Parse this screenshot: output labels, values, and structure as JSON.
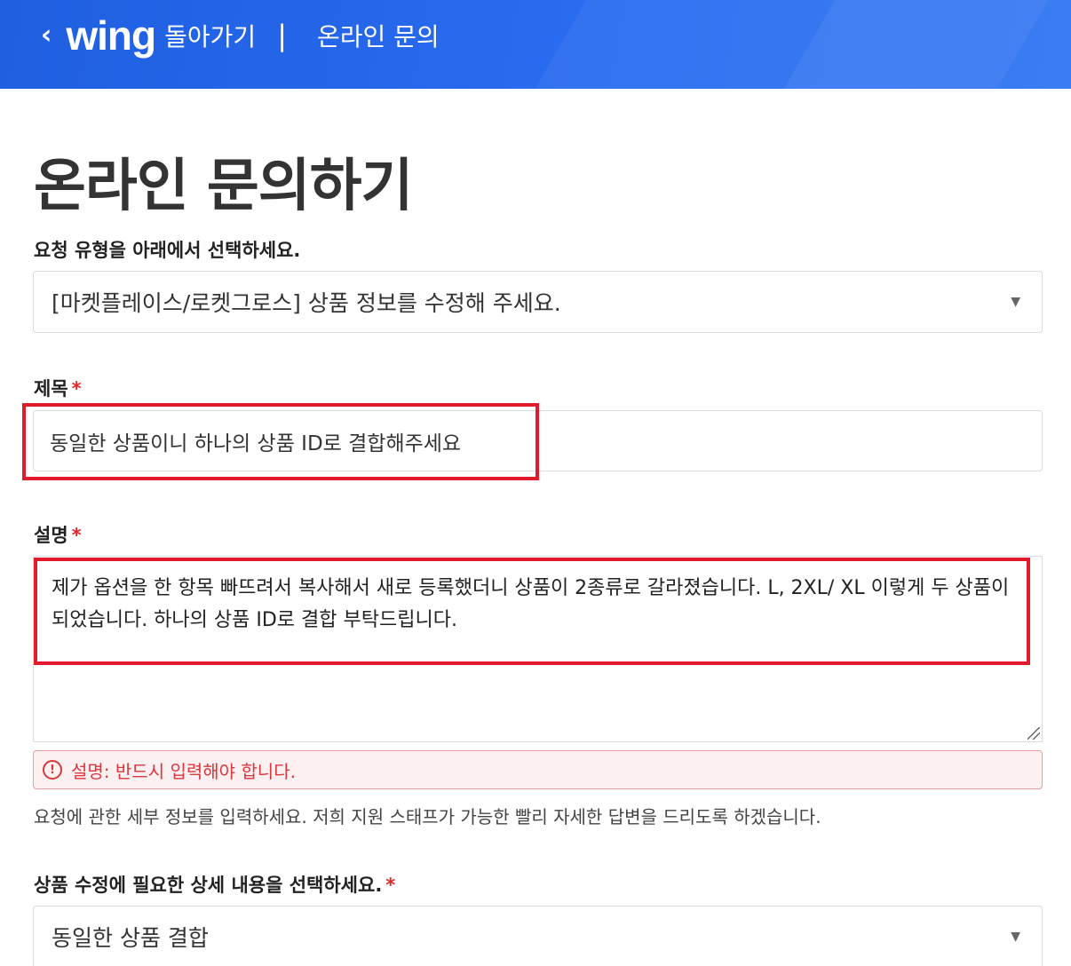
{
  "header": {
    "back_icon": "chevron-left-icon",
    "logo": "wing",
    "back_label": "돌아가기",
    "divider": "|",
    "breadcrumb": "온라인 문의"
  },
  "page": {
    "title": "온라인 문의하기"
  },
  "request_type": {
    "label": "요청 유형을 아래에서 선택하세요.",
    "value": "[마켓플레이스/로켓그로스] 상품 정보를 수정해 주세요.",
    "arrow": "▼"
  },
  "subject": {
    "label": "제목",
    "required": "*",
    "value": "동일한 상품이니 하나의 상품 ID로 결합해주세요"
  },
  "description": {
    "label": "설명",
    "required": "*",
    "value": "제가 옵션을 한 항목 빠뜨려서 복사해서 새로 등록했더니 상품이 2종류로 갈라졌습니다. L, 2XL/ XL 이렇게 두 상품이 되었습니다. 하나의 상품 ID로 결합 부탁드립니다.",
    "error_icon": "!",
    "error": "설명: 반드시 입력해야 합니다.",
    "help": "요청에 관한 세부 정보를 입력하세요. 저희 지원 스태프가 가능한 빨리 자세한 답변을 드리도록 하겠습니다."
  },
  "detail": {
    "label": "상품 수정에 필요한 상세 내용을 선택하세요.",
    "required": "*",
    "value": "동일한 상품 결합",
    "arrow": "▼"
  },
  "colors": {
    "header": "#2a6cf0",
    "highlight": "#e11b2b",
    "error": "#d9363e"
  }
}
